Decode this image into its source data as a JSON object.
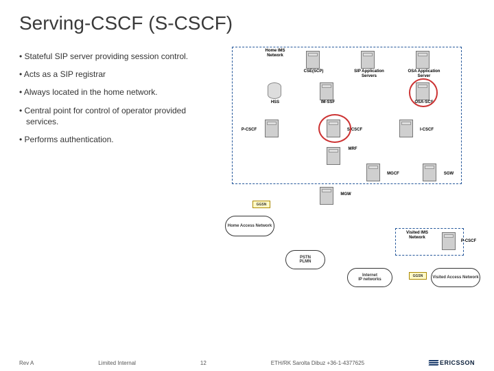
{
  "title": "Serving-CSCF (S-CSCF)",
  "bullets": [
    "Stateful SIP server providing session control.",
    "Acts as a SIP registrar",
    "Always located in the home network.",
    "Central point for control of operator provided services.",
    "Performs authentication."
  ],
  "diagram": {
    "home_ims_label": "Home IMS Network",
    "nodes": {
      "cse": "CSE(SCP)",
      "sip_as": "SIP Application Servers",
      "osa_as": "OSA Application Server",
      "hss": "HSS",
      "imssf": "IM-SSF",
      "osa_scs": "OSA-SCS",
      "pcscf_home": "P-CSCF",
      "scscf": "S-CSCF",
      "icscf": "I-CSCF",
      "mrf": "MRF",
      "mgcf": "MGCF",
      "sgw": "SGW",
      "mgw": "MGW"
    },
    "ggsn": "GGSN",
    "home_access": "Home Access Network",
    "visited_ims": "Visited IMS Network",
    "pcscf_visited": "P-CSCF",
    "pstn": "PSTN\nPLMN",
    "internet": "Internet\nIP networks",
    "visited_access": "Visited Access Network"
  },
  "footer": {
    "rev": "Rev A",
    "classification": "Limited Internal",
    "page": "12",
    "attribution": "ETH/RK Sarolta Dibuz +36-1-4377625",
    "logo": "ERICSSON"
  }
}
